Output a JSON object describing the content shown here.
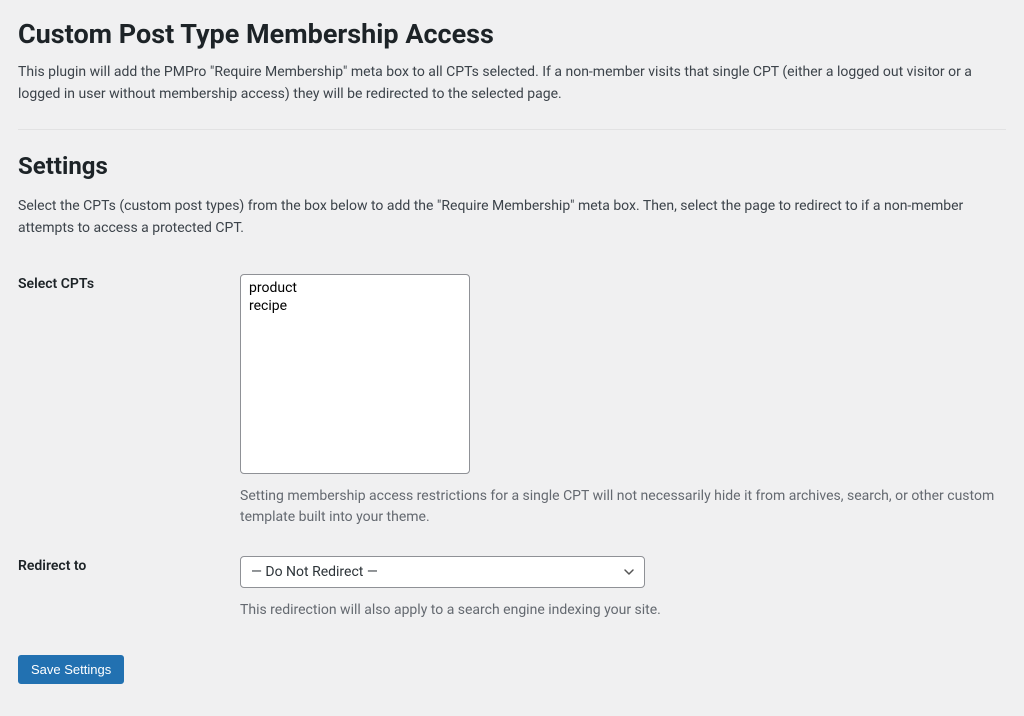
{
  "page": {
    "title": "Custom Post Type Membership Access",
    "intro": "This plugin will add the PMPro \"Require Membership\" meta box to all CPTs selected. If a non-member visits that single CPT (either a logged out visitor or a logged in user without membership access) they will be redirected to the selected page."
  },
  "settings": {
    "title": "Settings",
    "intro": "Select the CPTs (custom post types) from the box below to add the \"Require Membership\" meta box. Then, select the page to redirect to if a non-member attempts to access a protected CPT."
  },
  "fields": {
    "select_cpts": {
      "label": "Select CPTs",
      "options": [
        "product",
        "recipe"
      ],
      "description": "Setting membership access restrictions for a single CPT will not necessarily hide it from archives, search, or other custom template built into your theme."
    },
    "redirect_to": {
      "label": "Redirect to",
      "selected": "— Do Not Redirect —",
      "description": "This redirection will also apply to a search engine indexing your site."
    }
  },
  "buttons": {
    "save": "Save Settings"
  }
}
